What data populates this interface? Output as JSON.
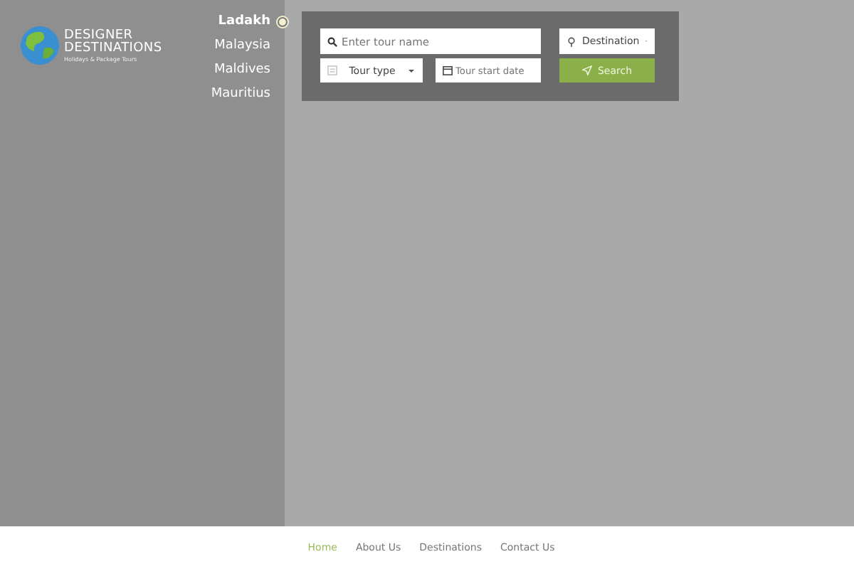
{
  "sidebar": {
    "menu": [
      {
        "label": "Ladakh",
        "selected": true
      },
      {
        "label": "Malaysia",
        "selected": false
      },
      {
        "label": "Maldives",
        "selected": false
      },
      {
        "label": "Mauritius",
        "selected": false
      }
    ]
  },
  "logo": {
    "title_line_1": "DESIGNER",
    "title_line_2": "DESTINATIONS",
    "tagline": "Holidays & Package Tours"
  },
  "search": {
    "tour_name": {
      "placeholder": "Enter tour name"
    },
    "destination": {
      "value": "Destination"
    },
    "tour_type": {
      "value": "Tour type"
    },
    "start_date": {
      "placeholder": "Tour start date"
    },
    "button": "Search"
  },
  "footer": {
    "nav": [
      {
        "label": "Home",
        "selected": true
      },
      {
        "label": "About Us",
        "selected": false
      },
      {
        "label": "Destinations",
        "selected": false
      },
      {
        "label": "Contact Us",
        "selected": false
      }
    ]
  }
}
